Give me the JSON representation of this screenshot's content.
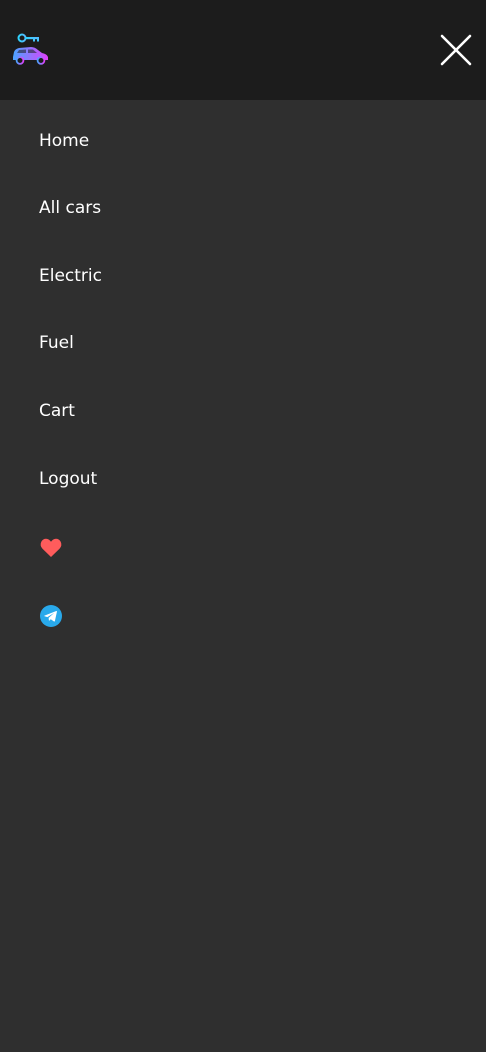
{
  "header": {
    "logo_icon": "car-with-key-logo-icon",
    "close_icon": "close-icon",
    "background_color": "#1c1c1c"
  },
  "menu": {
    "background_color": "#2f2f2f",
    "text_color": "#ffffff",
    "items": [
      {
        "label": "Home"
      },
      {
        "label": "All cars"
      },
      {
        "label": "Electric"
      },
      {
        "label": "Fuel"
      },
      {
        "label": "Cart"
      },
      {
        "label": "Logout"
      }
    ],
    "icon_links": [
      {
        "icon": "heart-icon",
        "color": "#ff5c5c"
      },
      {
        "icon": "telegram-icon",
        "color": "#29a9eb"
      }
    ]
  }
}
